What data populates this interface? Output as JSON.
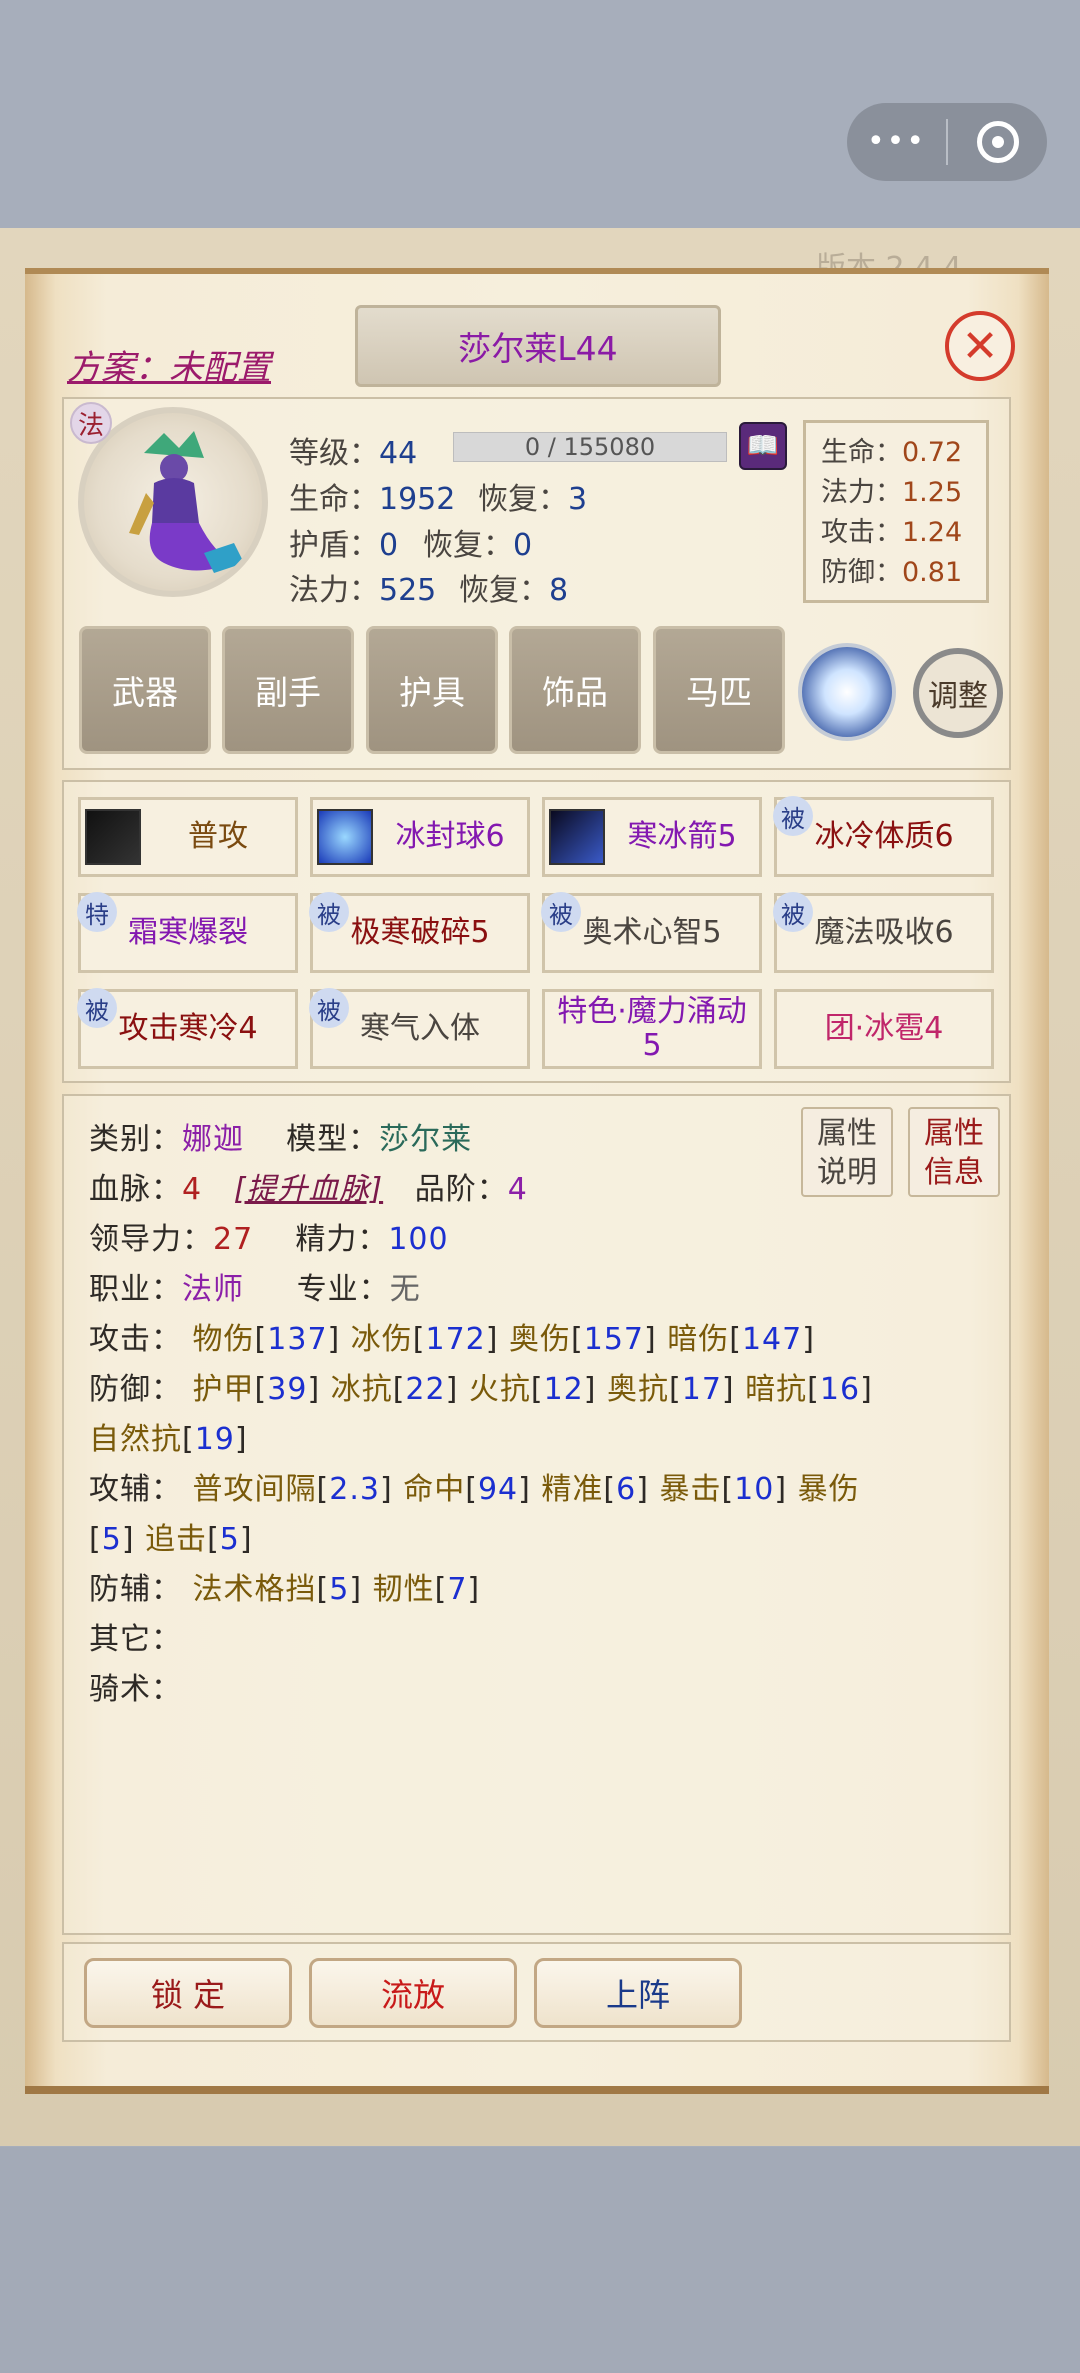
{
  "version_text": "版本 2.4.4",
  "scheme": "方案：未配置",
  "pet_name": "莎尔莱L44",
  "class_badge": "法",
  "stats": {
    "level_label": "等级：",
    "level": "44",
    "exp": "0 / 155080",
    "hp_label": "生命：",
    "hp": "1952",
    "hp_regen_label": "恢复：",
    "hp_regen": "3",
    "shield_label": "护盾：",
    "shield": "0",
    "shield_regen_label": "恢复：",
    "shield_regen": "0",
    "mp_label": "法力：",
    "mp": "525",
    "mp_regen_label": "恢复：",
    "mp_regen": "8"
  },
  "growth": [
    {
      "label": "生命：",
      "value": "0.72"
    },
    {
      "label": "法力：",
      "value": "1.25"
    },
    {
      "label": "攻击：",
      "value": "1.24"
    },
    {
      "label": "防御：",
      "value": "0.81"
    }
  ],
  "equipment": [
    "武器",
    "副手",
    "护具",
    "饰品",
    "马匹"
  ],
  "adjust_label": "调整",
  "skills": [
    {
      "name": "普攻",
      "tag": ""
    },
    {
      "name": "冰封球6",
      "tag": ""
    },
    {
      "name": "寒冰箭5",
      "tag": ""
    },
    {
      "name": "冰冷体质6",
      "tag": "被"
    },
    {
      "name": "霜寒爆裂",
      "tag": "特"
    },
    {
      "name": "极寒破碎5",
      "tag": "被"
    },
    {
      "name": "奥术心智5",
      "tag": "被"
    },
    {
      "name": "魔法吸收6",
      "tag": "被"
    },
    {
      "name": "攻击寒冷4",
      "tag": "被"
    },
    {
      "name": "寒气入体",
      "tag": "被"
    },
    {
      "name": "特色·魔力涌动",
      "name2": "5",
      "tag": ""
    },
    {
      "name": "团·冰雹4",
      "tag": ""
    }
  ],
  "info": {
    "type_label": "类别：",
    "type": "娜迦",
    "model_label": "模型：",
    "model": "莎尔莱",
    "blood_label": "血脉：",
    "blood": "4",
    "blood_upgrade": "[提升血脉]",
    "grade_label": "品阶：",
    "grade": "4",
    "leader_label": "领导力：",
    "leader": "27",
    "energy_label": "精力：",
    "energy": "100",
    "job_label": "职业：",
    "job": "法师",
    "spec_label": "专业：",
    "spec": "无",
    "attack_label": "攻击：",
    "attack_items": [
      {
        "name": "物伤",
        "value": "137"
      },
      {
        "name": "冰伤",
        "value": "172"
      },
      {
        "name": "奥伤",
        "value": "157"
      },
      {
        "name": "暗伤",
        "value": "147"
      }
    ],
    "defense_label": "防御：",
    "defense_items": [
      {
        "name": "护甲",
        "value": "39"
      },
      {
        "name": "冰抗",
        "value": "22"
      },
      {
        "name": "火抗",
        "value": "12"
      },
      {
        "name": "奥抗",
        "value": "17"
      },
      {
        "name": "暗抗",
        "value": "16"
      }
    ],
    "defense_items2": [
      {
        "name": "自然抗",
        "value": "19"
      }
    ],
    "atk_aux_label": "攻辅：",
    "atk_aux_items": [
      {
        "name": "普攻间隔",
        "value": "2.3"
      },
      {
        "name": "命中",
        "value": "94"
      },
      {
        "name": "精准",
        "value": "6"
      },
      {
        "name": "暴击",
        "value": "10"
      },
      {
        "name": "暴伤",
        "value": ""
      }
    ],
    "atk_aux_items2": [
      {
        "name": "",
        "value": "5"
      },
      {
        "name": "追击",
        "value": "5"
      }
    ],
    "def_aux_label": "防辅：",
    "def_aux_items": [
      {
        "name": "法术格挡",
        "value": "5"
      },
      {
        "name": "韧性",
        "value": "7"
      }
    ],
    "other_label": "其它：",
    "riding_label": "骑术："
  },
  "attr_buttons": [
    {
      "line1": "属性",
      "line2": "说明"
    },
    {
      "line1": "属性",
      "line2": "信息"
    }
  ],
  "actions": [
    "锁  定",
    "流放",
    "上阵"
  ],
  "colors": {
    "accent_purple": "#8318b0",
    "stat_blue": "#1e3f8f",
    "close_red": "#d43b2c"
  }
}
